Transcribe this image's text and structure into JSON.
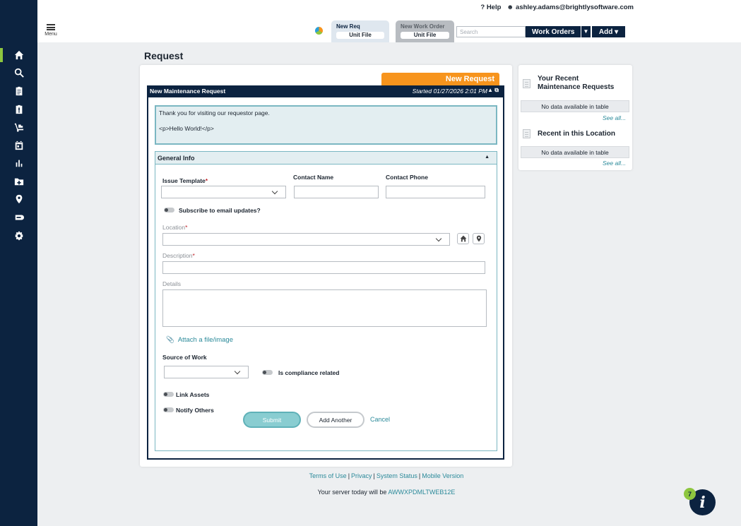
{
  "topbar": {
    "help": "Help",
    "user": "ashley.adams@brightlysoftware.com",
    "menu_label": "Menu",
    "tabs": [
      {
        "title": "New Req",
        "file": "Unit File"
      },
      {
        "title": "New Work Order",
        "file": "Unit File"
      }
    ],
    "search_placeholder": "Search",
    "work_orders": "Work Orders",
    "work_orders_caret": "▼",
    "add": "Add ▾"
  },
  "rail": {
    "items": [
      "home-icon",
      "search-icon",
      "clipboard-icon",
      "alert-clipboard-icon",
      "hand-truck-icon",
      "calendar-icon",
      "bar-chart-icon",
      "folder-icon",
      "location-pin-icon",
      "tag-icon",
      "gear-icon"
    ],
    "active": "home-icon"
  },
  "page": {
    "title": "Request"
  },
  "form": {
    "new_request_tab": "New Request",
    "header": "New Maintenance Request",
    "started": "Started 01/27/2026 2:01 PM",
    "header_icons": "▲ ⧉",
    "welcome_line1": "Thank you for visiting our requestor page.",
    "welcome_line2": "<p>Hello World!</p>",
    "section": "General Info",
    "section_arrow": "▲",
    "issue_template": "Issue Template",
    "contact_name": "Contact Name",
    "contact_phone": "Contact Phone",
    "subscribe": "Subscribe to email updates?",
    "location": "Location",
    "description": "Description",
    "details": "Details",
    "attach": "Attach a file/image",
    "source_of_work": "Source of Work",
    "compliance": "Is compliance related",
    "link_assets": "Link Assets",
    "notify_others": "Notify Others",
    "submit": "Submit",
    "add_another": "Add Another",
    "cancel": "Cancel",
    "required_mark": "*"
  },
  "side": {
    "recent_title_line1": "Your Recent",
    "recent_title_line2": "Maintenance Requests",
    "recent_nodata": "No data available in table",
    "recent_seeall": "See all...",
    "location_title": "Recent in this Location",
    "location_nodata": "No data available in table",
    "location_seeall": "See all..."
  },
  "footer": {
    "terms": "Terms of Use",
    "privacy": "Privacy",
    "status": "System Status",
    "mobile": "Mobile Version",
    "server_prefix": "Your server today will be",
    "server_name": "AWWXPDMLTWEB12E"
  },
  "info": {
    "badge": "7",
    "glyph": "i"
  },
  "colors": {
    "navy": "#0c2340",
    "orange": "#f7941d",
    "teal": "#2b8a9a",
    "green": "#8dc63f"
  }
}
